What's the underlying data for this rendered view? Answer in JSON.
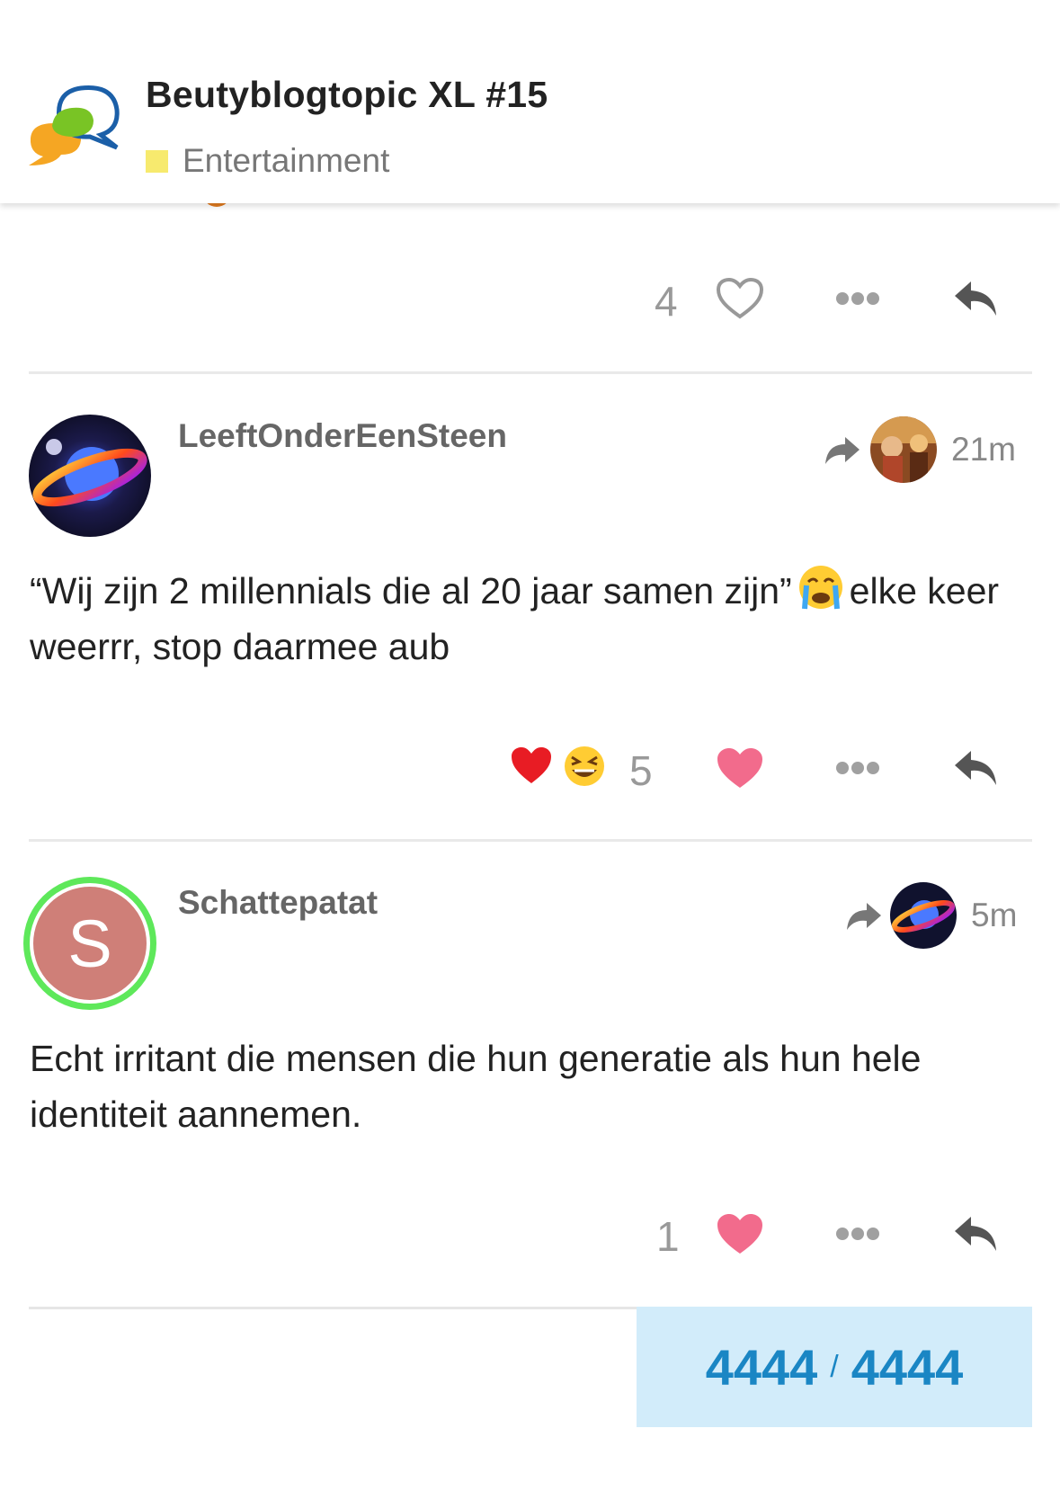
{
  "header": {
    "title": "Beutyblogtopic XL #15",
    "category": "Entertainment",
    "category_color": "#f7ea6e",
    "logo_icon": "chat-bubbles-logo-icon"
  },
  "posts": [
    {
      "likes": "4",
      "liked": false
    },
    {
      "username": "LeeftOnderEenSteen",
      "reply_to_avatar": "reply-avatar",
      "time": "21m",
      "text_part1": "“Wij zijn 2 millennials die al 20 jaar samen zijn”",
      "text_emoji": "crying-face-emoji",
      "text_part2": "elke keer weerrr, stop daarmee aub",
      "reactions": [
        "heart-emoji",
        "grinning-squinting-emoji"
      ],
      "likes": "5",
      "liked": true
    },
    {
      "username": "Schattepatat",
      "avatar_letter": "S",
      "avatar_color": "#cf7f78",
      "avatar_ring": "#5ee85a",
      "time": "5m",
      "text": "Echt irritant die mensen die hun generatie als hun hele identiteit aannemen.",
      "likes": "1",
      "liked": true
    }
  ],
  "progress": {
    "current": "4444",
    "separator": "/",
    "total": "4444"
  },
  "colors": {
    "like_active": "#f26b8c",
    "progress_bg": "#d2ecfa",
    "progress_text": "#1a86c4"
  }
}
